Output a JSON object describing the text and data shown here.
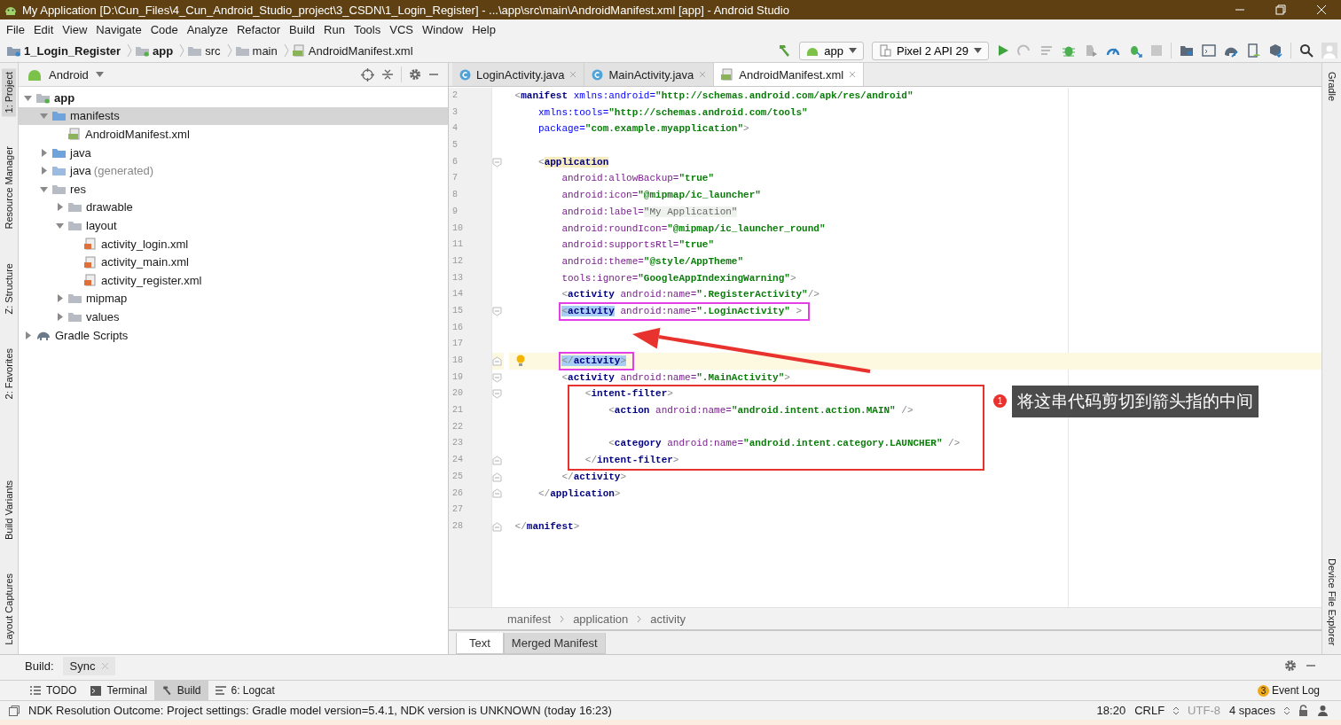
{
  "window": {
    "title": "My Application [D:\\Cun_Files\\4_Cun_Android_Studio_project\\3_CSDN\\1_Login_Register] - ...\\app\\src\\main\\AndroidManifest.xml [app] - Android Studio"
  },
  "menu": [
    "File",
    "Edit",
    "View",
    "Navigate",
    "Code",
    "Analyze",
    "Refactor",
    "Build",
    "Run",
    "Tools",
    "VCS",
    "Window",
    "Help"
  ],
  "breadcrumb": [
    "1_Login_Register",
    "app",
    "src",
    "main",
    "AndroidManifest.xml"
  ],
  "toolbar": {
    "run_config": "app",
    "device": "Pixel 2 API 29"
  },
  "left_strip": [
    {
      "label": "1: Project",
      "selected": true
    },
    {
      "label": "Resource Manager",
      "selected": false
    },
    {
      "label": "Z: Structure",
      "selected": false
    },
    {
      "label": "2: Favorites",
      "selected": false
    },
    {
      "label": "Build Variants",
      "selected": false
    },
    {
      "label": "Layout Captures",
      "selected": false
    }
  ],
  "right_strip": [
    "Gradle",
    "Device File Explorer"
  ],
  "project": {
    "view": "Android",
    "tree": [
      {
        "name": "app",
        "kind": "module",
        "expanded": true,
        "selected": false,
        "children": [
          {
            "name": "manifests",
            "kind": "source-folder",
            "expanded": true,
            "selected": true,
            "children": [
              {
                "name": "AndroidManifest.xml",
                "kind": "manifest",
                "selected": false
              }
            ]
          },
          {
            "name": "java",
            "kind": "source-folder",
            "expanded": false,
            "selected": false
          },
          {
            "name": "java",
            "note": "(generated)",
            "kind": "generated-folder",
            "expanded": false,
            "selected": false
          },
          {
            "name": "res",
            "kind": "folder",
            "expanded": true,
            "selected": false,
            "children": [
              {
                "name": "drawable",
                "kind": "folder",
                "expanded": false,
                "selected": false
              },
              {
                "name": "layout",
                "kind": "folder",
                "expanded": true,
                "selected": false,
                "children": [
                  {
                    "name": "activity_login.xml",
                    "kind": "layout",
                    "selected": false
                  },
                  {
                    "name": "activity_main.xml",
                    "kind": "layout",
                    "selected": false
                  },
                  {
                    "name": "activity_register.xml",
                    "kind": "layout",
                    "selected": false
                  }
                ]
              },
              {
                "name": "mipmap",
                "kind": "folder",
                "expanded": false,
                "selected": false
              },
              {
                "name": "values",
                "kind": "folder",
                "expanded": false,
                "selected": false
              }
            ]
          }
        ]
      },
      {
        "name": "Gradle Scripts",
        "kind": "gradle",
        "expanded": false,
        "selected": false
      }
    ]
  },
  "editor_tabs": [
    {
      "label": "LoginActivity.java",
      "kind": "class",
      "selected": false
    },
    {
      "label": "MainActivity.java",
      "kind": "class",
      "selected": false
    },
    {
      "label": "AndroidManifest.xml",
      "kind": "manifest",
      "selected": true
    }
  ],
  "code_lines": [
    {
      "number": "2",
      "segments": [
        {
          "kind": "bracket",
          "text": "<"
        },
        {
          "kind": "tag",
          "text": "manifest"
        },
        {
          "kind": "ns",
          "text": " xmlns:android="
        },
        {
          "kind": "value",
          "text": "\"http://schemas.android.com/apk/res/android\""
        }
      ]
    },
    {
      "number": "3",
      "segments": [
        {
          "kind": "ns",
          "text": "    xmlns:tools="
        },
        {
          "kind": "value",
          "text": "\"http://schemas.android.com/tools\""
        }
      ]
    },
    {
      "number": "4",
      "segments": [
        {
          "kind": "ns",
          "text": "    package="
        },
        {
          "kind": "value",
          "text": "\"com.example.myapplication\""
        },
        {
          "kind": "bracket",
          "text": ">"
        }
      ]
    },
    {
      "number": "5"
    },
    {
      "number": "6",
      "fold_start": true,
      "segments": [
        {
          "kind": "bracket",
          "text": "    <"
        },
        {
          "kind": "tag",
          "text": "application",
          "matched": true
        }
      ]
    },
    {
      "number": "7",
      "segments": [
        {
          "kind": "attr",
          "text": "        android:allowBackup="
        },
        {
          "kind": "value",
          "text": "\"true\""
        }
      ]
    },
    {
      "number": "8",
      "segments": [
        {
          "kind": "attr",
          "text": "        android:icon="
        },
        {
          "kind": "value",
          "text": "\"@mipmap/ic_launcher\""
        }
      ]
    },
    {
      "number": "9",
      "segments": [
        {
          "kind": "attr",
          "text": "        android:label="
        },
        {
          "kind": "folded",
          "text": "\"My Application\""
        }
      ]
    },
    {
      "number": "10",
      "segments": [
        {
          "kind": "attr",
          "text": "        android:roundIcon="
        },
        {
          "kind": "value",
          "text": "\"@mipmap/ic_launcher_round\""
        }
      ]
    },
    {
      "number": "11",
      "segments": [
        {
          "kind": "attr",
          "text": "        android:supportsRtl="
        },
        {
          "kind": "value",
          "text": "\"true\""
        }
      ]
    },
    {
      "number": "12",
      "segments": [
        {
          "kind": "attr",
          "text": "        android:theme="
        },
        {
          "kind": "value",
          "text": "\"@style/AppTheme\""
        }
      ]
    },
    {
      "number": "13",
      "segments": [
        {
          "kind": "attr",
          "text": "        tools:ignore="
        },
        {
          "kind": "value",
          "text": "\"GoogleAppIndexingWarning\""
        },
        {
          "kind": "bracket",
          "text": ">"
        }
      ]
    },
    {
      "number": "14",
      "segments": [
        {
          "kind": "bracket",
          "text": "        <"
        },
        {
          "kind": "tag",
          "text": "activity"
        },
        {
          "kind": "attr",
          "text": " android:name="
        },
        {
          "kind": "value",
          "text": "\".RegisterActivity\""
        },
        {
          "kind": "bracket",
          "text": "/>"
        }
      ]
    },
    {
      "number": "15",
      "fold_start": true,
      "marked": true,
      "segments": [
        {
          "kind": "bracket",
          "text": "        <",
          "selected": true
        },
        {
          "kind": "tag",
          "text": "activity",
          "selected": true
        },
        {
          "kind": "attr",
          "text": " android:name="
        },
        {
          "kind": "value",
          "text": "\".LoginActivity\""
        },
        {
          "kind": "bracket",
          "text": " >"
        }
      ]
    },
    {
      "number": "16"
    },
    {
      "number": "17"
    },
    {
      "number": "18",
      "fold_end": true,
      "current": true,
      "bulb": true,
      "marked": true,
      "segments": [
        {
          "kind": "bracket",
          "text": "        </",
          "selected": true
        },
        {
          "kind": "tag",
          "text": "activity",
          "selected": true
        },
        {
          "kind": "bracket",
          "text": ">",
          "selected": true
        }
      ]
    },
    {
      "number": "19",
      "fold_start": true,
      "segments": [
        {
          "kind": "bracket",
          "text": "        <"
        },
        {
          "kind": "tag",
          "text": "activity"
        },
        {
          "kind": "attr",
          "text": " android:name="
        },
        {
          "kind": "value",
          "text": "\".MainActivity\""
        },
        {
          "kind": "bracket",
          "text": ">"
        }
      ]
    },
    {
      "number": "20",
      "fold_start": true,
      "framed": true,
      "segments": [
        {
          "kind": "bracket",
          "text": "            <"
        },
        {
          "kind": "tag",
          "text": "intent-filter"
        },
        {
          "kind": "bracket",
          "text": ">"
        }
      ]
    },
    {
      "number": "21",
      "framed": true,
      "segments": [
        {
          "kind": "bracket",
          "text": "                <"
        },
        {
          "kind": "tag",
          "text": "action"
        },
        {
          "kind": "attr",
          "text": " android:name="
        },
        {
          "kind": "value",
          "text": "\"android.intent.action.MAIN\""
        },
        {
          "kind": "bracket",
          "text": " />"
        }
      ]
    },
    {
      "number": "22",
      "framed": true
    },
    {
      "number": "23",
      "framed": true,
      "segments": [
        {
          "kind": "bracket",
          "text": "                <"
        },
        {
          "kind": "tag",
          "text": "category"
        },
        {
          "kind": "attr",
          "text": " android:name="
        },
        {
          "kind": "value",
          "text": "\"android.intent.category.LAUNCHER\""
        },
        {
          "kind": "bracket",
          "text": " />"
        }
      ]
    },
    {
      "number": "24",
      "fold_end": true,
      "framed": true,
      "segments": [
        {
          "kind": "bracket",
          "text": "            </"
        },
        {
          "kind": "tag",
          "text": "intent-filter"
        },
        {
          "kind": "bracket",
          "text": ">"
        }
      ]
    },
    {
      "number": "25",
      "fold_end": true,
      "segments": [
        {
          "kind": "bracket",
          "text": "        </"
        },
        {
          "kind": "tag",
          "text": "activity"
        },
        {
          "kind": "bracket",
          "text": ">"
        }
      ]
    },
    {
      "number": "26",
      "fold_end": true,
      "segments": [
        {
          "kind": "bracket",
          "text": "    </"
        },
        {
          "kind": "tag",
          "text": "application"
        },
        {
          "kind": "bracket",
          "text": ">"
        }
      ]
    },
    {
      "number": "27"
    },
    {
      "number": "28",
      "fold_end": true,
      "segments": [
        {
          "kind": "bracket",
          "text": "</"
        },
        {
          "kind": "tag",
          "text": "manifest"
        },
        {
          "kind": "bracket",
          "text": ">"
        }
      ]
    }
  ],
  "annotation": {
    "badge": "1",
    "note": "将这串代码剪切到箭头指的中间"
  },
  "xml_path": [
    "manifest",
    "application",
    "activity"
  ],
  "view_tabs": [
    {
      "label": "Text",
      "selected": true
    },
    {
      "label": "Merged Manifest",
      "selected": false
    }
  ],
  "build_panel": {
    "label": "Build:",
    "tabs": [
      "Sync"
    ]
  },
  "tool_tabs": [
    {
      "label": "TODO",
      "kind": "list",
      "selected": false
    },
    {
      "label": "Terminal",
      "kind": "terminal",
      "selected": false
    },
    {
      "label": "Build",
      "kind": "hammer",
      "selected": true
    },
    {
      "label": "6: Logcat",
      "kind": "logcat",
      "selected": false
    }
  ],
  "event_log": {
    "label": "Event Log",
    "count": "3"
  },
  "status_bar": {
    "message": "NDK Resolution Outcome: Project settings: Gradle model version=5.4.1, NDK version is UNKNOWN (today 16:23)",
    "position": "18:20",
    "line_separator": "CRLF",
    "encoding": "UTF-8",
    "indent": "4 spaces"
  }
}
